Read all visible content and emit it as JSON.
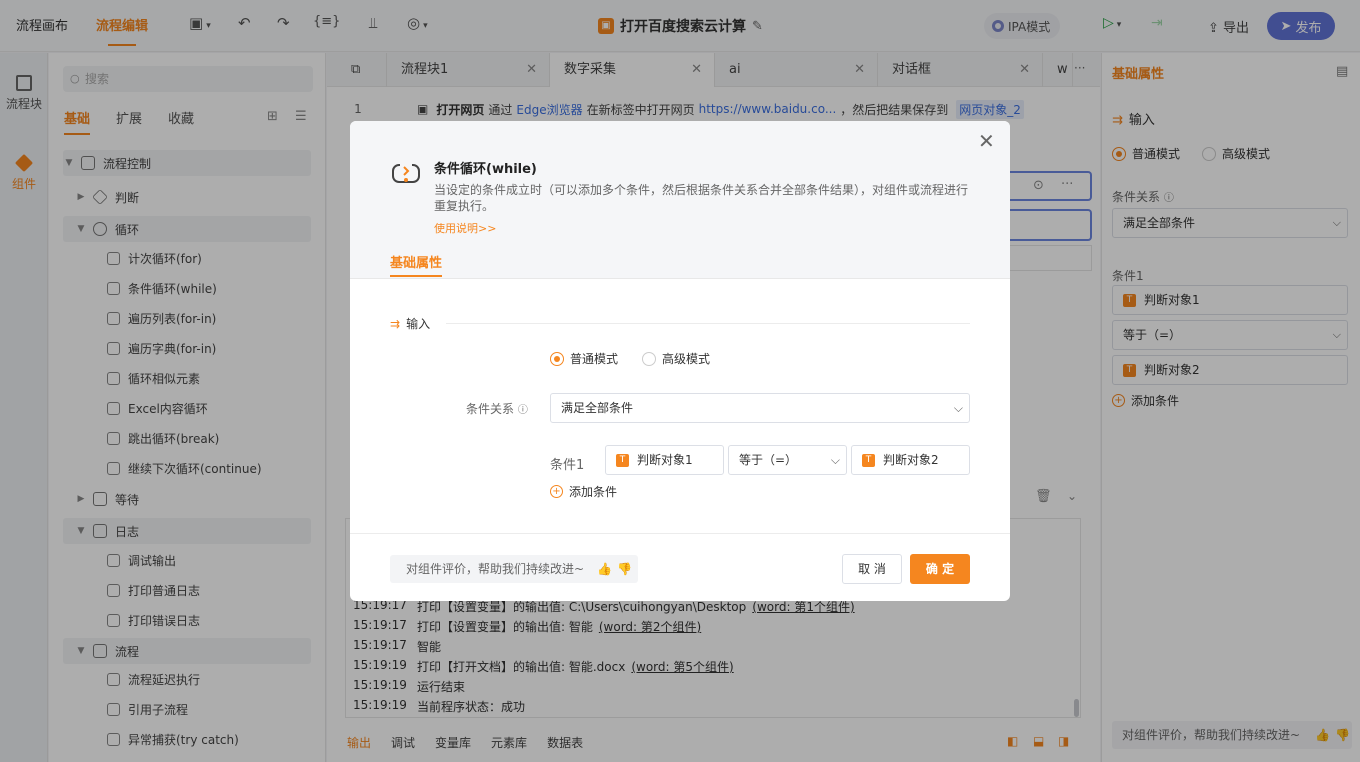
{
  "topbar": {
    "tab_canvas": "流程画布",
    "tab_edit": "流程编辑",
    "title": "打开百度搜索云计算",
    "ipa_label": "IPA模式",
    "export_label": "导出",
    "publish_label": "发布",
    "brace_icon": "{≡}"
  },
  "leftnav": {
    "blocks_label": "流程块",
    "components_label": "组件"
  },
  "panel": {
    "search_placeholder": "搜索",
    "tabs": [
      "基础",
      "扩展",
      "收藏"
    ],
    "tree": [
      {
        "label": "流程控制",
        "level": 0,
        "expanded": true
      },
      {
        "label": "判断",
        "level": 1,
        "expanded": false
      },
      {
        "label": "循环",
        "level": 1,
        "expanded": true
      },
      {
        "label": "计次循环(for)",
        "level": 2
      },
      {
        "label": "条件循环(while)",
        "level": 2
      },
      {
        "label": "遍历列表(for-in)",
        "level": 2
      },
      {
        "label": "遍历字典(for-in)",
        "level": 2
      },
      {
        "label": "循环相似元素",
        "level": 2
      },
      {
        "label": "Excel内容循环",
        "level": 2
      },
      {
        "label": "跳出循环(break)",
        "level": 2
      },
      {
        "label": "继续下次循环(continue)",
        "level": 2
      },
      {
        "label": "等待",
        "level": 1,
        "expanded": false
      },
      {
        "label": "日志",
        "level": 1,
        "expanded": true
      },
      {
        "label": "调试输出",
        "level": 2
      },
      {
        "label": "打印普通日志",
        "level": 2
      },
      {
        "label": "打印错误日志",
        "level": 2
      },
      {
        "label": "流程",
        "level": 1,
        "expanded": true
      },
      {
        "label": "流程延迟执行",
        "level": 2
      },
      {
        "label": "引用子流程",
        "level": 2
      },
      {
        "label": "异常捕获(try catch)",
        "level": 2
      }
    ]
  },
  "editor": {
    "tabs": [
      "流程块1",
      "数字采集",
      "ai",
      "对话框",
      "w"
    ],
    "tab_overflow": "···",
    "line1": {
      "number": "1",
      "keyword": "打开网页",
      "t1": "通过",
      "browser": "Edge浏览器",
      "t2": "在新标签中打开网页",
      "url": "https://www.baidu.co...",
      "t3": "，然后把结果保存到",
      "var": "网页对象_2"
    },
    "log_lines": [
      {
        "time": "15:19:17",
        "text": "打印【设置变量】的输出值: C:\\Users\\cuihongyan\\Desktop",
        "link": "(word: 第1个组件)"
      },
      {
        "time": "15:19:17",
        "text": "打印【设置变量】的输出值: 智能",
        "link": "(word: 第2个组件)"
      },
      {
        "time": "15:19:17",
        "text": "智能",
        "link": ""
      },
      {
        "time": "15:19:19",
        "text": "打印【打开文档】的输出值: 智能.docx",
        "link": "(word: 第5个组件)"
      },
      {
        "time": "15:19:19",
        "text": "运行结束",
        "link": ""
      },
      {
        "time": "15:19:19",
        "text": "当前程序状态：成功",
        "link": ""
      }
    ],
    "bottom_tabs": [
      "输出",
      "调试",
      "变量库",
      "元素库",
      "数据表"
    ]
  },
  "right": {
    "title": "基础属性",
    "section_input": "输入",
    "mode_normal": "普通模式",
    "mode_advanced": "高级模式",
    "relation_label": "条件关系",
    "relation_value": "满足全部条件",
    "condition1_label": "条件1",
    "obj1": "判断对象1",
    "op": "等于（=）",
    "obj2": "判断对象2",
    "add_condition": "添加条件",
    "feedback": "对组件评价，帮助我们持续改进~"
  },
  "modal": {
    "title": "条件循环(while)",
    "description": "当设定的条件成立时（可以添加多个条件，然后根据条件关系合并全部条件结果），对组件或流程进行重复执行。",
    "help_link": "使用说明>>",
    "tab": "基础属性",
    "section_input": "输入",
    "mode_normal": "普通模式",
    "mode_advanced": "高级模式",
    "relation_label": "条件关系",
    "relation_value": "满足全部条件",
    "condition1_label": "条件1",
    "obj1": "判断对象1",
    "op": "等于（=）",
    "obj2": "判断对象2",
    "add_condition": "添加条件",
    "feedback": "对组件评价，帮助我们持续改进~",
    "cancel": "取 消",
    "ok": "确 定"
  },
  "colors": {
    "accent": "#f5861f",
    "publish": "#6173d6",
    "link": "#3b6fe0",
    "run": "#2aa146"
  }
}
